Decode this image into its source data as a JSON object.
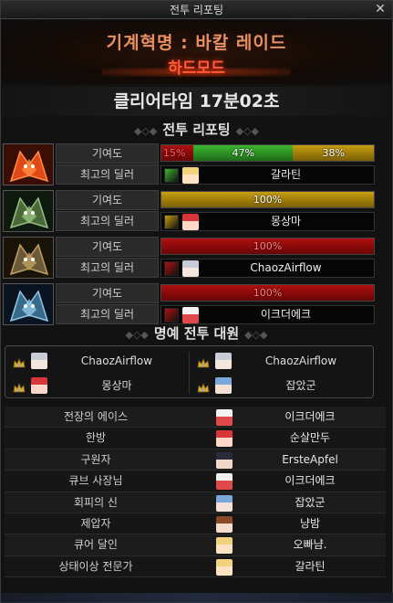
{
  "window": {
    "title": "전투 리포팅",
    "close_label": "✕"
  },
  "header": {
    "raid_name": "기계혁명 : 바칼 레이드",
    "mode": "하드모드"
  },
  "clear_time": "클리어타임  17분02초",
  "battle_section_title": "전투 리포팅",
  "labels": {
    "contribution": "기여도",
    "best_dealer": "최고의 딜러"
  },
  "bosses": [
    {
      "portrait": "red-dragon-boss",
      "contribution": [
        {
          "label": "15%",
          "value": 15,
          "color": "#b01010"
        },
        {
          "label": "47%",
          "value": 47,
          "color": "#3cb830"
        },
        {
          "label": "38%",
          "value": 38,
          "color": "#c8a010"
        }
      ],
      "dealer": {
        "job_color": "#3cb830",
        "avatar": "blonde-avatar",
        "name": "갈라틴"
      }
    },
    {
      "portrait": "green-dragon-boss",
      "contribution": [
        {
          "label": "100%",
          "value": 100,
          "color": "#c8a010"
        }
      ],
      "dealer": {
        "job_color": "#c8a010",
        "avatar": "red-hair-avatar",
        "name": "몽상마"
      }
    },
    {
      "portrait": "gold-dragon-boss",
      "contribution": [
        {
          "label": "100%",
          "value": 100,
          "color": "#b01010"
        }
      ],
      "dealer": {
        "job_color": "#b01010",
        "avatar": "silver-hair-avatar",
        "name": "ChaozAirflow"
      }
    },
    {
      "portrait": "ice-dragon-boss",
      "contribution": [
        {
          "label": "100%",
          "value": 100,
          "color": "#b01010"
        }
      ],
      "dealer": {
        "job_color": "#b01010",
        "avatar": "white-cap-avatar",
        "name": "이크더에크"
      }
    }
  ],
  "honor_section_title": "명예 전투 대원",
  "honor_members": [
    {
      "name": "ChaozAirflow",
      "avatar": "silver-hair-avatar"
    },
    {
      "name": "ChaozAirflow",
      "avatar": "silver-hair-avatar"
    },
    {
      "name": "몽상마",
      "avatar": "red-hair-avatar"
    },
    {
      "name": "잡았군",
      "avatar": "blue-outfit-avatar"
    }
  ],
  "awards": [
    {
      "title": "전장의 에이스",
      "name": "이크더에크",
      "avatar": "white-cap-avatar"
    },
    {
      "title": "한방",
      "name": "순살만두",
      "avatar": "red-hair-avatar"
    },
    {
      "title": "구원자",
      "name": "ErsteApfel",
      "avatar": "dark-hair-avatar"
    },
    {
      "title": "큐브 사장님",
      "name": "이크더에크",
      "avatar": "white-cap-avatar"
    },
    {
      "title": "회피의 신",
      "name": "잡았군",
      "avatar": "blue-outfit-avatar"
    },
    {
      "title": "제압자",
      "name": "냥밤",
      "avatar": "brown-hair-avatar"
    },
    {
      "title": "큐어 달인",
      "name": "오빠냠.",
      "avatar": "blonde-avatar"
    },
    {
      "title": "상태이상 전문가",
      "name": "갈라틴",
      "avatar": "blonde-avatar"
    }
  ]
}
